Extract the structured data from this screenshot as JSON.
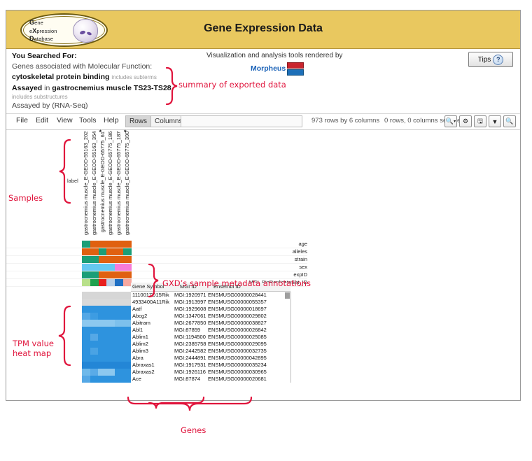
{
  "header": {
    "title": "Gene Expression Data",
    "logo": {
      "line1": "Gene",
      "line2": "eXpression",
      "line3": "Database",
      "icon": "embryo-icon"
    }
  },
  "search_summary": {
    "heading": "You Searched For:",
    "line1": "Genes associated with Molecular Function:",
    "line2_bold": "cytoskeletal protein binding",
    "line2_note": "includes subterms",
    "line3_a": "Assayed",
    "line3_b": " in ",
    "line3_c": "gastrocnemius muscle TS23-TS28",
    "line4_note": "includes substructures",
    "line5": "Assayed by (RNA-Seq)"
  },
  "attribution": {
    "text": "Visualization and analysis tools rendered by",
    "product": "Morpheus",
    "logo_red": "#c9252d",
    "logo_blue": "#1d6fb8"
  },
  "tips_button": {
    "label": "Tips",
    "icon": "question-mark-icon"
  },
  "toolbar": {
    "menus": [
      "File",
      "Edit",
      "View",
      "Tools",
      "Help"
    ],
    "toggle_rows": "Rows",
    "toggle_columns": "Columns",
    "caret": "▾",
    "search_placeholder": "",
    "search_value": "",
    "dimensions_text": "973 rows by 6 columns",
    "selection_text": "0 rows, 0 columns selected",
    "icons": [
      "search-zoom-icon",
      "gear-icon",
      "save-image-icon",
      "filter-icon",
      "magnifier-icon"
    ]
  },
  "columns": {
    "axis_label": "label",
    "samples": [
      {
        "name": "gastrocnemius muscle_E-GEOD-55163_202",
        "starred": false
      },
      {
        "name": "gastrocnemius muscle_E-GEOD-55163_354",
        "starred": false
      },
      {
        "name": "gastrocnemius muscle_E-GEOD-65775_61",
        "starred": true
      },
      {
        "name": "gastrocnemius muscle_E-GEOD-65775_186",
        "starred": false
      },
      {
        "name": "gastrocnemius muscle_E-GEOD-65775_187",
        "starred": false
      },
      {
        "name": "gastrocnemius muscle_E-GEOD-65775_390",
        "starred": true
      }
    ]
  },
  "sample_metadata": {
    "rows": [
      {
        "name": "age",
        "colors": [
          "#1b9e77",
          "#e06010",
          "#e06010",
          "#e06010",
          "#e06010",
          "#e06010"
        ]
      },
      {
        "name": "alleles",
        "colors": [
          "#e06010",
          "#e06010",
          "#1b9e77",
          "#e06010",
          "#e06010",
          "#1b9e77"
        ]
      },
      {
        "name": "strain",
        "colors": [
          "#1b9e77",
          "#1b9e77",
          "#e06010",
          "#e06010",
          "#e06010",
          "#e06010"
        ]
      },
      {
        "name": "sex",
        "colors": [
          "#64c8f0",
          "#64c8f0",
          "#64c8f0",
          "#64c8f0",
          "#f77bd8",
          "#f77bd8"
        ]
      },
      {
        "name": "expID",
        "colors": [
          "#1b9e77",
          "#1b9e77",
          "#e06010",
          "#e06010",
          "#e06010",
          "#e06010"
        ]
      },
      {
        "name": "MGI_BioReplicateSet_ID",
        "colors": [
          "#b8e08a",
          "#1fa04f",
          "#e8201e",
          "#b8cfe8",
          "#1f6fc4",
          "#f7a8a0"
        ]
      }
    ]
  },
  "gene_table": {
    "headers": [
      "Gene Symbol",
      "MGI ID",
      "Ensembl ID"
    ],
    "rows": [
      {
        "symbol": "1110017D15Rik",
        "mgi": "MGI:1920971",
        "ensembl": "ENSMUSG00000028441",
        "heat": [
          "#d6d6d6",
          "#d6d6d6",
          "#d6d6d6",
          "#d6d6d6",
          "#d6d6d6",
          "#d6d6d6"
        ]
      },
      {
        "symbol": "4933400A11Rik",
        "mgi": "MGI:1913997",
        "ensembl": "ENSMUSG00000055357",
        "heat": [
          "#d9d9d9",
          "#d9d9d9",
          "#d9d9d9",
          "#d9d9d9",
          "#d9d9d9",
          "#d9d9d9"
        ]
      },
      {
        "symbol": "Aatf",
        "mgi": "MGI:1929608",
        "ensembl": "ENSMUSG00000018697",
        "heat": [
          "#2e93de",
          "#2e93de",
          "#2e93de",
          "#2e93de",
          "#2e93de",
          "#2e93de"
        ]
      },
      {
        "symbol": "Abcg2",
        "mgi": "MGI:1347061",
        "ensembl": "ENSMUSG00000029802",
        "heat": [
          "#55a8e6",
          "#3d9ce2",
          "#2e93de",
          "#2e93de",
          "#2e93de",
          "#2e93de"
        ]
      },
      {
        "symbol": "Abitram",
        "mgi": "MGI:2677850",
        "ensembl": "ENSMUSG00000038827",
        "heat": [
          "#8cc8ef",
          "#8cc8ef",
          "#8cc8ef",
          "#8cc8ef",
          "#7dc0ec",
          "#7dc0ec"
        ]
      },
      {
        "symbol": "Abl1",
        "mgi": "MGI:87859",
        "ensembl": "ENSMUSG00000026842",
        "heat": [
          "#2e93de",
          "#2e93de",
          "#2e93de",
          "#2e93de",
          "#2e93de",
          "#2e93de"
        ]
      },
      {
        "symbol": "Ablim1",
        "mgi": "MGI:1194500",
        "ensembl": "ENSMUSG00000025085",
        "heat": [
          "#2e93de",
          "#55a8e6",
          "#2e93de",
          "#2e93de",
          "#2e93de",
          "#2e93de"
        ]
      },
      {
        "symbol": "Ablim2",
        "mgi": "MGI:2385758",
        "ensembl": "ENSMUSG00000029095",
        "heat": [
          "#2e93de",
          "#2e93de",
          "#2e93de",
          "#2e93de",
          "#2e93de",
          "#2e93de"
        ]
      },
      {
        "symbol": "Ablim3",
        "mgi": "MGI:2442582",
        "ensembl": "ENSMUSG00000032735",
        "heat": [
          "#2e93de",
          "#4aa3e4",
          "#2e93de",
          "#2e93de",
          "#2e93de",
          "#2e93de"
        ]
      },
      {
        "symbol": "Abra",
        "mgi": "MGI:2444891",
        "ensembl": "ENSMUSG00000042895",
        "heat": [
          "#2e93de",
          "#2e93de",
          "#2e93de",
          "#2e93de",
          "#2e93de",
          "#2e93de"
        ]
      },
      {
        "symbol": "Abraxas1",
        "mgi": "MGI:1917931",
        "ensembl": "ENSMUSG00000035234",
        "heat": [
          "#2386d6",
          "#2386d6",
          "#2386d6",
          "#2386d6",
          "#2386d6",
          "#2386d6"
        ]
      },
      {
        "symbol": "Abraxas2",
        "mgi": "MGI:1926116",
        "ensembl": "ENSMUSG00000030965",
        "heat": [
          "#6fb9ea",
          "#5aabe7",
          "#8cc8ef",
          "#8cc8ef",
          "#2e93de",
          "#2e93de"
        ]
      },
      {
        "symbol": "Ace",
        "mgi": "MGI:87874",
        "ensembl": "ENSMUSG00000020681",
        "heat": [
          "#55a8e6",
          "#2e93de",
          "#2e93de",
          "#2e93de",
          "#2e93de",
          "#2e93de"
        ]
      }
    ]
  },
  "annotations": {
    "samples": "Samples",
    "metadata": "GXD’s sample metadata annotations",
    "heatmap_line1": "TPM value",
    "heatmap_line2": "heat map",
    "genes": "Genes",
    "summary": "summary of exported data",
    "color": "#e0143c"
  }
}
